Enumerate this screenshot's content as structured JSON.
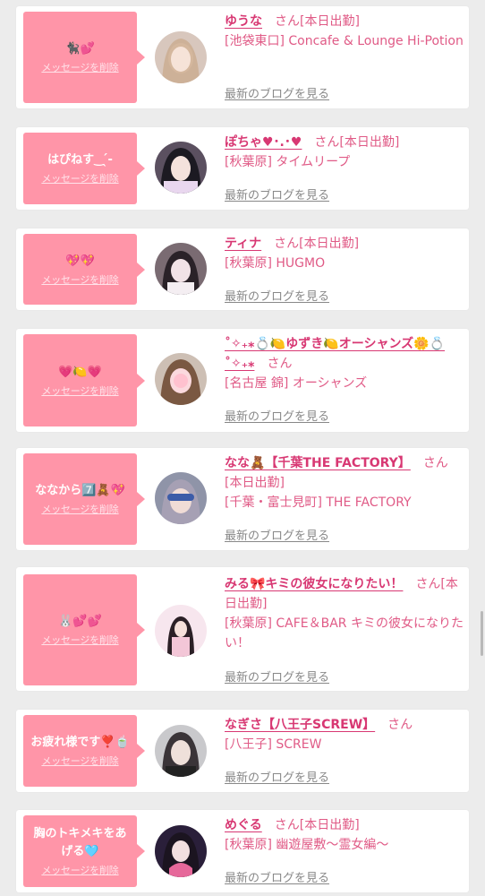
{
  "entries": [
    {
      "message": "🐈‍⬛💕",
      "delete_label": "メッセージを削除",
      "name": "ゆうな",
      "suffix": "さん[本日出勤]",
      "shop": "[池袋東口] Concafe & Lounge Hi-Potion",
      "blog_label": "最新のブログを見る"
    },
    {
      "message": "はぴねす‿ ̖́-",
      "delete_label": "メッセージを削除",
      "name": "ぽちゃ♥︎･.･♥︎",
      "suffix": "さん[本日出勤]",
      "shop": "[秋葉原] タイムリープ",
      "blog_label": "最新のブログを見る"
    },
    {
      "message": "💖💖",
      "delete_label": "メッセージを削除",
      "name": "ティナ",
      "suffix": "さん[本日出勤]",
      "shop": "[秋葉原] HUGMO",
      "blog_label": "最新のブログを見る"
    },
    {
      "message": "💗🍋💗",
      "delete_label": "メッセージを削除",
      "name": "˚✧₊⁎💍🍋ゆずき🍋オーシャンズ🌼💍˚✧₊⁎",
      "suffix": "さん",
      "shop": "[名古屋 錦] オーシャンズ",
      "blog_label": "最新のブログを見る"
    },
    {
      "message": "ななから7️⃣🧸💖",
      "delete_label": "メッセージを削除",
      "name": "なな🧸【千葉THE FACTORY】",
      "suffix": "さん[本日出勤]",
      "shop": "[千葉・富士見町] THE FACTORY",
      "blog_label": "最新のブログを見る"
    },
    {
      "message": "🐰💕💕",
      "delete_label": "メッセージを削除",
      "name": "みる🎀キミの彼女になりたい！",
      "suffix": "さん[本日出勤]",
      "shop": "[秋葉原] CAFE＆BAR キミの彼女になりたい！",
      "blog_label": "最新のブログを見る"
    },
    {
      "message": "お疲れ様です❣️🍵",
      "delete_label": "メッセージを削除",
      "name": "なぎさ【八王子SCREW】",
      "suffix": "さん",
      "shop": "[八王子] SCREW",
      "blog_label": "最新のブログを見る"
    },
    {
      "message": "胸のトキメキをあげる🩵",
      "delete_label": "メッセージを削除",
      "name": "めぐる",
      "suffix": "さん[本日出勤]",
      "shop": "[秋葉原] 幽遊屋敷〜霊女編〜",
      "blog_label": "最新のブログを見る"
    }
  ],
  "colors": {
    "bubble": "#ff95a8",
    "name": "#d83873",
    "text": "#e05a86",
    "link_gray": "#888888",
    "background": "#ececec"
  }
}
